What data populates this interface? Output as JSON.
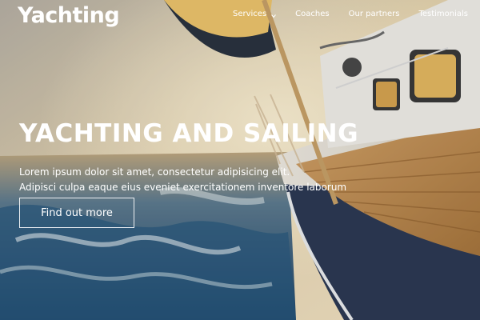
{
  "brand": {
    "logo": "Yachting"
  },
  "nav": {
    "items": [
      {
        "label": "Services",
        "has_dropdown": true
      },
      {
        "label": "Coaches",
        "has_dropdown": false
      },
      {
        "label": "Our partners",
        "has_dropdown": false
      },
      {
        "label": "Testimonials",
        "has_dropdown": false
      }
    ]
  },
  "hero": {
    "title": "YACHTING AND SAILING",
    "line1": "Lorem ipsum dolor sit amet, consectetur adipisicing elit.",
    "line2": "Adipisci culpa eaque eius eveniet exercitationem inventore laborum",
    "cta": "Find out more"
  },
  "colors": {
    "text": "#ffffff",
    "sky": "#e9d3a3",
    "sea": "#2f5f86",
    "hull": "#e8e5de"
  }
}
